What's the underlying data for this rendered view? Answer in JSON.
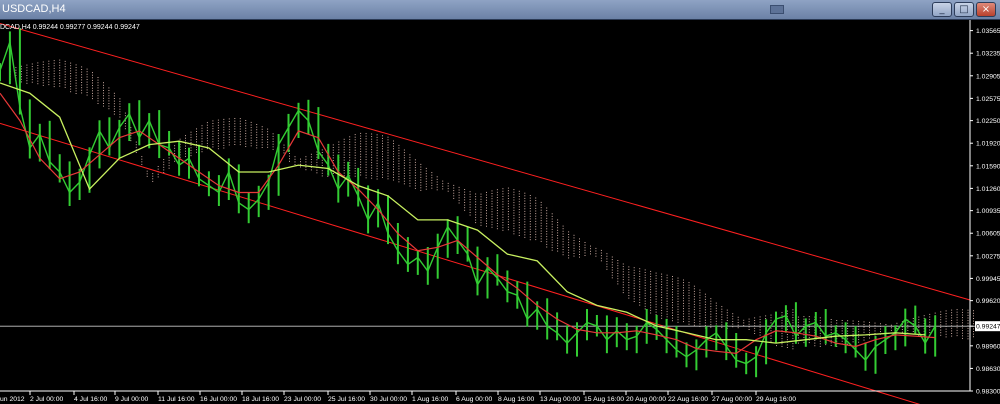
{
  "window": {
    "title": "USDCAD,H4",
    "buttons": {
      "minimize": "_",
      "maximize": "□",
      "close": "×"
    }
  },
  "chart_info": {
    "symbol": "DCAD,H4",
    "ohlc": "0.99244 0.99277 0.99244 0.99247"
  },
  "chart_data": {
    "type": "line",
    "title": "",
    "instrument": "USDCAD",
    "timeframe": "H4",
    "y_ticks": [
      "1.03565",
      "1.03235",
      "1.02905",
      "1.02575",
      "1.02250",
      "1.01920",
      "1.01590",
      "1.01260",
      "1.00935",
      "1.00605",
      "1.00275",
      "0.99945",
      "0.99620",
      "0.99247",
      "0.98960",
      "0.98630",
      "0.98300"
    ],
    "current_price": "0.99247",
    "x_ticks": [
      "un 2012",
      "2 Jul 00:00",
      "4 Jul 16:00",
      "9 Jul 00:00",
      "11 Jul 16:00",
      "16 Jul 00:00",
      "18 Jul 16:00",
      "23 Jul 00:00",
      "25 Jul 16:00",
      "30 Jul 00:00",
      "1 Aug 16:00",
      "6 Aug 00:00",
      "8 Aug 16:00",
      "13 Aug 00:00",
      "15 Aug 16:00",
      "20 Aug 00:00",
      "22 Aug 16:00",
      "27 Aug 00:00",
      "29 Aug 16:00"
    ],
    "ylim": [
      0.983,
      1.0372
    ],
    "grid": false,
    "colors": {
      "background": "#000000",
      "price": "#33cc33",
      "tenkan": "#e83838",
      "kijun": "#c8f060",
      "cloud": "#c8a9a0",
      "channel": "#ff2020",
      "axis_text": "#ffffff"
    },
    "series": [
      {
        "x": [
          0,
          2,
          4,
          6,
          8,
          10,
          12,
          14,
          16,
          18,
          20,
          22,
          24,
          26,
          28,
          30,
          32,
          34,
          36,
          38,
          40,
          42,
          44,
          46,
          48,
          50,
          52,
          54,
          56,
          58,
          60,
          62,
          64,
          66,
          68,
          70,
          72,
          74,
          76,
          78,
          80,
          82,
          84,
          86,
          88,
          90,
          92,
          94,
          96,
          98,
          100,
          102,
          104,
          106,
          108,
          110,
          112,
          114,
          116,
          118,
          120,
          122,
          124,
          126,
          128,
          130,
          132,
          134,
          136,
          138,
          140,
          142,
          144,
          146,
          148,
          150,
          152,
          154,
          156,
          158,
          160,
          162,
          164,
          166,
          168,
          170,
          172,
          174,
          176,
          178,
          180,
          182,
          184,
          186,
          188
        ],
        "values": [
          1.0298,
          1.034,
          1.0245,
          1.0185,
          1.0205,
          1.0165,
          1.015,
          1.012,
          1.0135,
          1.0175,
          1.021,
          1.0185,
          1.0215,
          1.0235,
          1.02,
          1.0225,
          1.019,
          1.0185,
          1.016,
          1.017,
          1.014,
          1.013,
          1.012,
          1.015,
          1.0105,
          1.0095,
          1.011,
          1.0135,
          1.019,
          1.0215,
          1.024,
          1.0225,
          1.018,
          1.016,
          1.0125,
          1.0145,
          1.0115,
          1.008,
          1.0105,
          1.006,
          1.0035,
          1.0015,
          1.0025,
          1.0005,
          1.004,
          1.007,
          1.005,
          1.003,
          0.9985,
          1.001,
          0.9995,
          0.9975,
          0.997,
          0.9935,
          0.995,
          0.9925,
          0.9915,
          0.99,
          0.9915,
          0.993,
          0.9925,
          0.9905,
          0.9918,
          0.9905,
          0.991,
          0.993,
          0.992,
          0.9905,
          0.989,
          0.988,
          0.989,
          0.9905,
          0.9915,
          0.9895,
          0.9875,
          0.987,
          0.988,
          0.9915,
          0.9935,
          0.994,
          0.991,
          0.9925,
          0.993,
          0.991,
          0.9915,
          0.9905,
          0.989,
          0.9875,
          0.9895,
          0.9905,
          0.9915,
          0.9935,
          0.9925,
          0.99,
          0.9925
        ]
      },
      {
        "x": [
          0,
          4,
          8,
          12,
          16,
          20,
          24,
          28,
          32,
          36,
          40,
          44,
          48,
          52,
          56,
          60,
          64,
          68,
          72,
          76,
          80,
          84,
          88,
          92,
          96,
          100,
          104,
          108,
          112,
          116,
          120,
          124,
          128,
          132,
          136,
          140,
          144,
          148,
          152,
          156,
          160,
          164,
          168,
          172,
          176,
          180,
          184,
          188
        ],
        "values": [
          1.0265,
          1.0225,
          1.017,
          1.014,
          1.015,
          1.0175,
          1.02,
          1.021,
          1.019,
          1.017,
          1.015,
          1.013,
          1.012,
          1.012,
          1.016,
          1.021,
          1.02,
          1.015,
          1.0125,
          1.0095,
          1.006,
          1.0035,
          1.004,
          1.005,
          1.0025,
          1.0,
          0.998,
          0.9955,
          0.9935,
          0.992,
          0.9915,
          0.9915,
          0.9918,
          0.9912,
          0.9905,
          0.9892,
          0.9888,
          0.9885,
          0.9905,
          0.9918,
          0.9915,
          0.991,
          0.99,
          0.9895,
          0.9905,
          0.9912,
          0.991,
          0.9908
        ]
      },
      {
        "x": [
          0,
          6,
          12,
          18,
          24,
          30,
          36,
          42,
          48,
          54,
          60,
          66,
          72,
          78,
          84,
          90,
          96,
          102,
          108,
          114,
          120,
          126,
          132,
          138,
          144,
          150,
          156,
          162,
          168,
          174,
          180,
          186
        ],
        "values": [
          1.028,
          1.0265,
          1.023,
          1.0125,
          1.017,
          1.019,
          1.0195,
          1.0185,
          1.015,
          1.015,
          1.016,
          1.0155,
          1.013,
          1.0115,
          1.008,
          1.008,
          1.0065,
          1.003,
          1.002,
          0.9975,
          0.9955,
          0.9945,
          0.9925,
          0.9915,
          0.9905,
          0.9905,
          0.99,
          0.9905,
          0.991,
          0.9912,
          0.9915,
          0.9912
        ]
      }
    ]
  }
}
